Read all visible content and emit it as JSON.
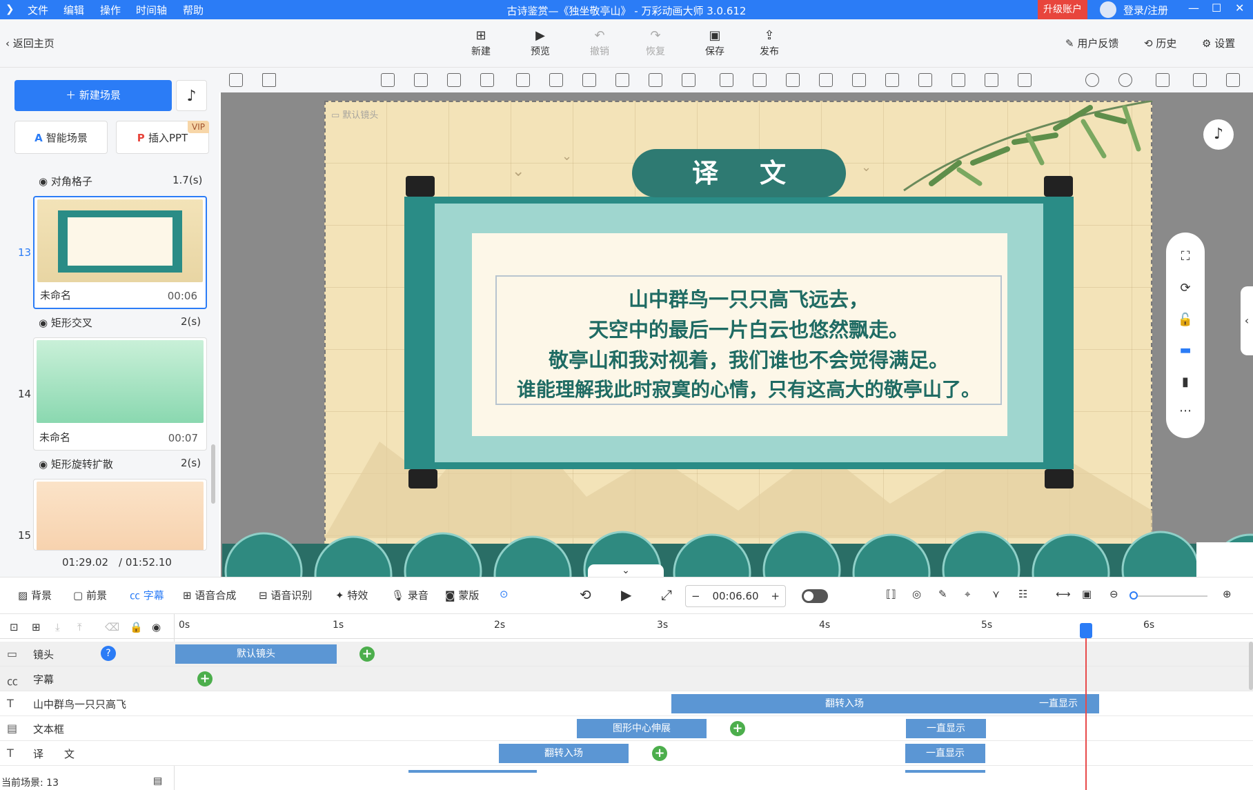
{
  "titlebar": {
    "menus": [
      "文件",
      "编辑",
      "操作",
      "时间轴",
      "帮助"
    ],
    "title": "古诗鉴赏—《独坐敬亭山》 - 万彩动画大师 3.0.612",
    "upgrade": "升级账户",
    "login": "登录/注册"
  },
  "toolbar": {
    "back": "返回主页",
    "new": "新建",
    "preview": "预览",
    "undo": "撤销",
    "redo": "恢复",
    "save": "保存",
    "publish": "发布",
    "feedback": "用户反馈",
    "history": "历史",
    "settings": "设置"
  },
  "left": {
    "new_scene": "新建场景",
    "smart_scene": "智能场景",
    "insert_ppt": "插入PPT",
    "vip": "VIP",
    "scenes": [
      {
        "transition": "对角格子",
        "trans_time": "1.7(s)",
        "index": "13",
        "name": "未命名",
        "duration": "00:06"
      },
      {
        "transition": "矩形交叉",
        "trans_time": "2(s)",
        "index": "14",
        "name": "未命名",
        "duration": "00:07"
      },
      {
        "transition": "矩形旋转扩散",
        "trans_time": "2(s)",
        "index": "15"
      }
    ],
    "current_time": "01:29.02",
    "total_time": "/ 01:52.10"
  },
  "stage": {
    "camera_label": "默认镜头",
    "banner": "译文",
    "poem": [
      "山中群鸟一只只高飞远去，",
      "天空中的最后一片白云也悠然飘走。",
      "敬亭山和我对视着，我们谁也不会觉得满足。",
      "谁能理解我此时寂寞的心情，只有这高大的敬亭山了。"
    ]
  },
  "tabs": {
    "background": "背景",
    "foreground": "前景",
    "subtitle": "字幕",
    "tts": "语音合成",
    "asr": "语音识别",
    "effects": "特效",
    "record": "录音",
    "mask": "蒙版"
  },
  "playback": {
    "time": "00:06.60"
  },
  "timeline": {
    "ticks": [
      "0s",
      "1s",
      "2s",
      "3s",
      "4s",
      "5s",
      "6s"
    ],
    "rows": [
      {
        "label": "镜头",
        "clips": [
          "默认镜头"
        ]
      },
      {
        "label": "字幕"
      },
      {
        "label": "山中群鸟一只只高飞",
        "clips": [
          "翻转入场",
          "一直显示"
        ]
      },
      {
        "label": "文本框",
        "clips": [
          "图形中心伸展",
          "一直显示"
        ]
      },
      {
        "label": "译　　文",
        "clips": [
          "翻转入场",
          "一直显示"
        ]
      }
    ]
  },
  "status": {
    "current_scene": "当前场景: 13"
  }
}
